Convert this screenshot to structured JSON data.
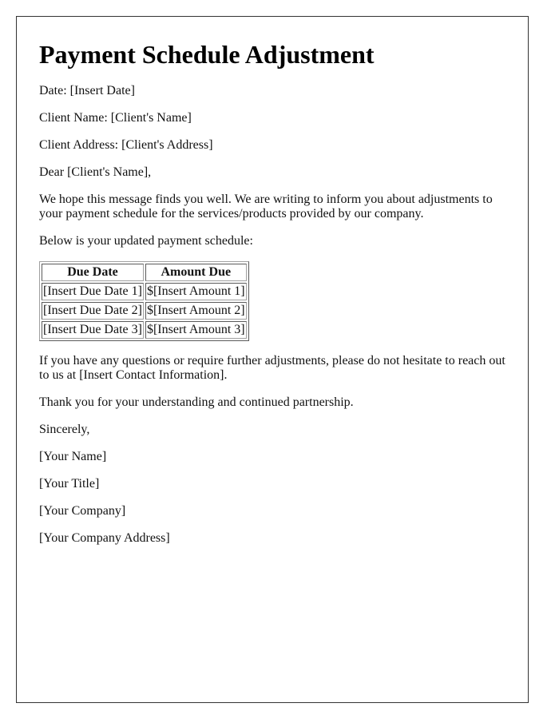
{
  "letter": {
    "title": "Payment Schedule Adjustment",
    "date_line": "Date: [Insert Date]",
    "client_name_line": "Client Name: [Client's Name]",
    "client_address_line": "Client Address: [Client's Address]",
    "salutation": "Dear [Client's Name],",
    "intro_paragraph": "We hope this message finds you well. We are writing to inform you about adjustments to your payment schedule for the services/products provided by our company.",
    "schedule_intro": "Below is your updated payment schedule:",
    "schedule_table": {
      "headers": [
        "Due Date",
        "Amount Due"
      ],
      "rows": [
        [
          "[Insert Due Date 1]",
          "$[Insert Amount 1]"
        ],
        [
          "[Insert Due Date 2]",
          "$[Insert Amount 2]"
        ],
        [
          "[Insert Due Date 3]",
          "$[Insert Amount 3]"
        ]
      ]
    },
    "contact_paragraph": "If you have any questions or require further adjustments, please do not hesitate to reach out to us at [Insert Contact Information].",
    "thanks_paragraph": "Thank you for your understanding and continued partnership.",
    "closing": "Sincerely,",
    "signature": {
      "name": "[Your Name]",
      "title": "[Your Title]",
      "company": "[Your Company]",
      "company_address": "[Your Company Address]"
    }
  }
}
